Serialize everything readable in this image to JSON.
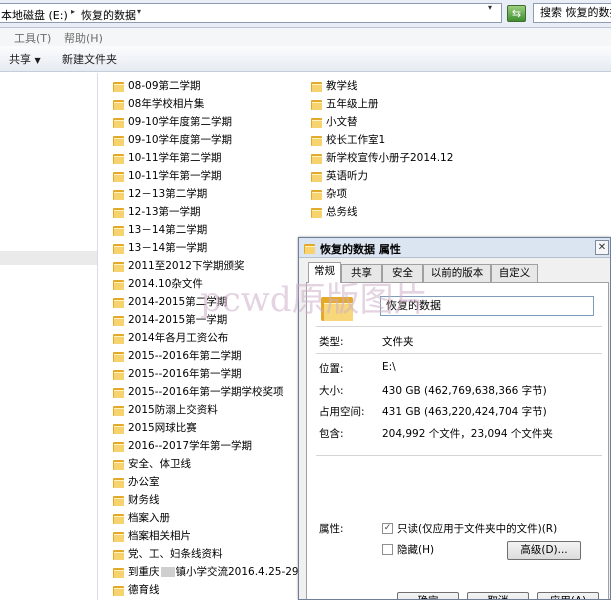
{
  "address_bar": {
    "crumbs": [
      "本地磁盘 (E:)",
      "恢复的数据"
    ],
    "search_placeholder": "搜索 恢复的数据"
  },
  "menu": {
    "items": [
      "工具(T)",
      "帮助(H)"
    ]
  },
  "toolbar": {
    "share_label": "共享",
    "new_folder_label": "新建文件夹"
  },
  "files": {
    "column1": [
      "08-09第二学期",
      "08年学校相片集",
      "09-10学年度第二学期",
      "09-10学年度第一学期",
      "10-11学年第二学期",
      "10-11学年第一学期",
      "12－13第二学期",
      "12-13第一学期",
      "13－14第二学期",
      "13－14第一学期",
      "2011至2012下学期颁奖",
      "2014.10杂文件",
      "2014-2015第二学期",
      "2014-2015第一学期",
      "2014年各月工资公布",
      "2015--2016年第二学期",
      "2015--2016年第一学期",
      "2015--2016年第一学期学校奖项",
      "2015防溺上交资料",
      "2015网球比赛",
      "2016--2017学年第一学期",
      "安全、体卫线",
      "办公室",
      "财务线",
      "档案入册",
      "档案相关相片",
      "党、工、妇条线资料",
      "到重庆",
      "镇小学交流2016.4.25-29",
      "德育线"
    ],
    "column2": [
      "教学线",
      "五年级上册",
      "小文替",
      "校长工作室1",
      "新学校宣传小册子2014.12",
      "英语听力",
      "杂项",
      "总务线"
    ]
  },
  "dialog": {
    "title": "恢复的数据 属性",
    "close_label": "✕",
    "tabs": [
      "常规",
      "共享",
      "安全",
      "以前的版本",
      "自定义"
    ],
    "folder_name": "恢复的数据",
    "type_label": "类型:",
    "type_value": "文件夹",
    "location_label": "位置:",
    "location_value": "E:\\",
    "size_label": "大小:",
    "size_value": "430 GB (462,769,638,366 字节)",
    "disk_size_label": "占用空间:",
    "disk_size_value": "431 GB (463,220,424,704 字节)",
    "contains_label": "包含:",
    "contains_value": "204,992 个文件，23,094 个文件夹",
    "attributes_label": "属性:",
    "readonly_label": "只读(仅应用于文件夹中的文件)(R)",
    "readonly_mark": "✓",
    "hidden_label": "隐藏(H)",
    "advanced_label": "高级(D)...",
    "ok_label": "确定",
    "cancel_label": "取消",
    "apply_label": "应用(A)"
  },
  "watermark": "pcwd原版图片"
}
